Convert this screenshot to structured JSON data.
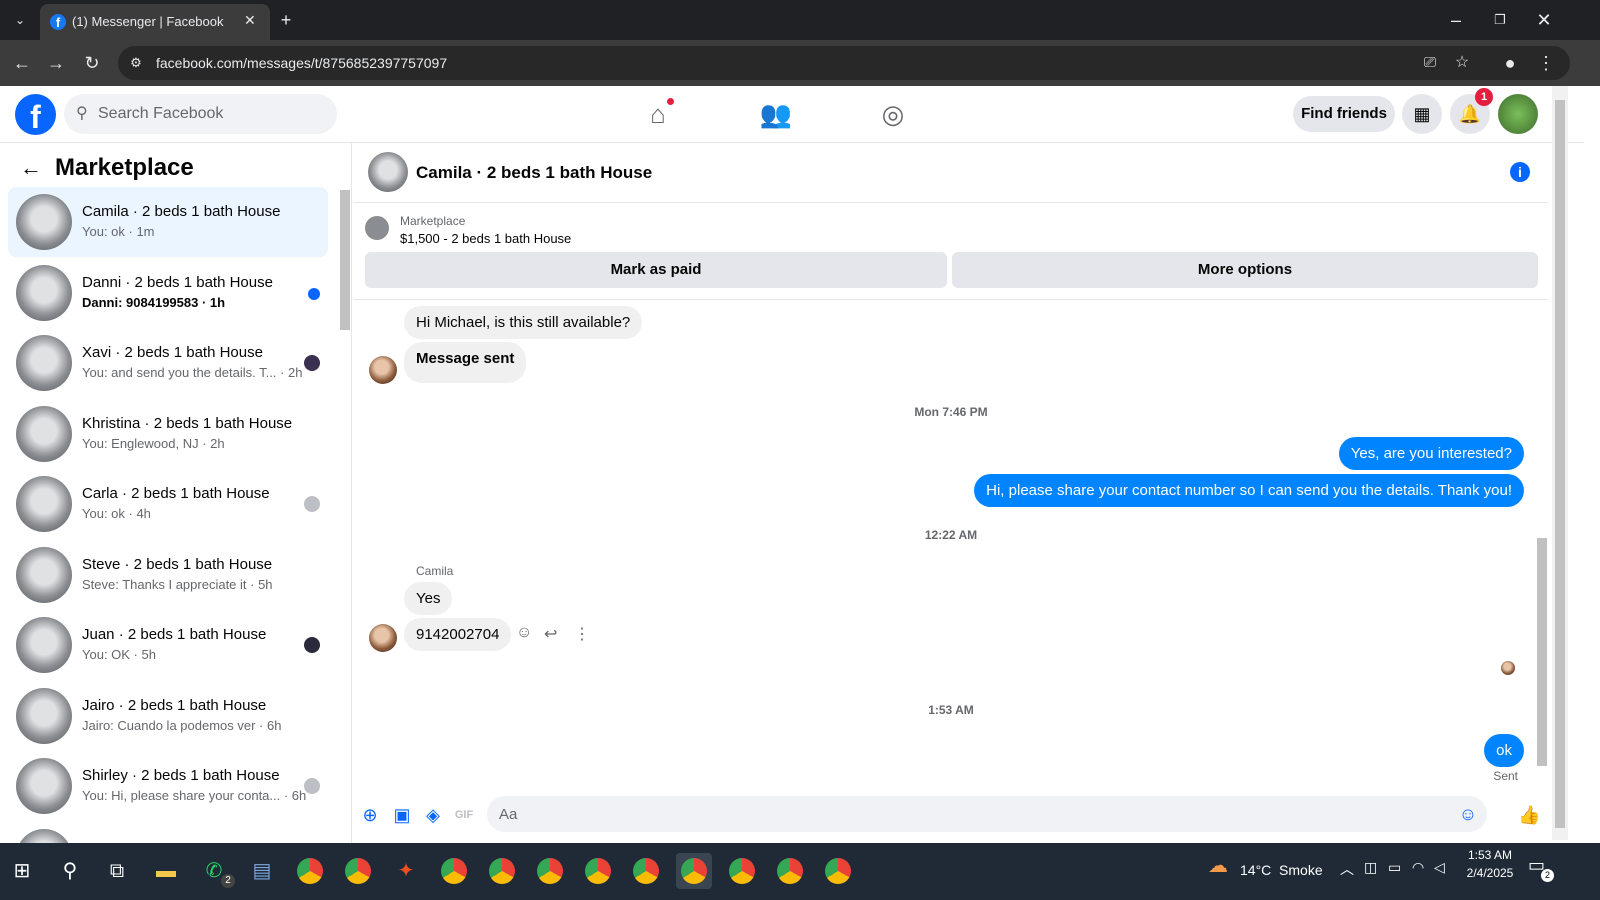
{
  "browser": {
    "tab_title": "(1) Messenger | Facebook",
    "url": "facebook.com/messages/t/8756852397757097"
  },
  "header": {
    "search_placeholder": "Search Facebook",
    "find_friends": "Find friends",
    "notif_count": "1"
  },
  "sidebar": {
    "title": "Marketplace",
    "items": [
      {
        "name": "Camila · 2 beds 1 bath House",
        "preview": "You: ok · 1m"
      },
      {
        "name": "Danni · 2 beds 1 bath House",
        "preview": "Danni: 9084199583 · 1h"
      },
      {
        "name": "Xavi · 2 beds 1 bath House",
        "preview": "You: and send you the details. T... · 2h"
      },
      {
        "name": "Khristina · 2 beds 1 bath House",
        "preview": "You: Englewood, NJ · 2h"
      },
      {
        "name": "Carla · 2 beds 1 bath House",
        "preview": "You: ok · 4h"
      },
      {
        "name": "Steve · 2 beds 1 bath House",
        "preview": "Steve: Thanks I appreciate it · 5h"
      },
      {
        "name": "Juan · 2 beds 1 bath House",
        "preview": "You: OK · 5h"
      },
      {
        "name": "Jairo · 2 beds 1 bath House",
        "preview": "Jairo: Cuando la podemos ver · 6h"
      },
      {
        "name": "Shirley · 2 beds 1 bath House",
        "preview": "You: Hi, please share your conta... · 6h"
      }
    ]
  },
  "chat": {
    "title": "Camila · 2 beds 1 bath House",
    "marketplace_label": "Marketplace",
    "listing": "$1,500 - 2 beds 1 bath House",
    "mark_paid": "Mark as paid",
    "more_options": "More options",
    "msgs": {
      "m1": "Hi Michael, is this still available?",
      "m2": "Message sent",
      "ts1": "Mon 7:46 PM",
      "m3": "Yes, are you interested?",
      "m4": "Hi, please share your contact number so I can send you the details. Thank you!",
      "ts2": "12:22 AM",
      "sender": "Camila",
      "m5": "Yes",
      "m6": "9142002704",
      "ts3": "1:53 AM",
      "m7": "ok",
      "sent": "Sent"
    },
    "composer_placeholder": "Aa"
  },
  "taskbar": {
    "weather": "14°C  Smoke",
    "time": "1:53 AM",
    "date": "2/4/2025",
    "wa_badge": "2",
    "notif_badge": "2"
  }
}
